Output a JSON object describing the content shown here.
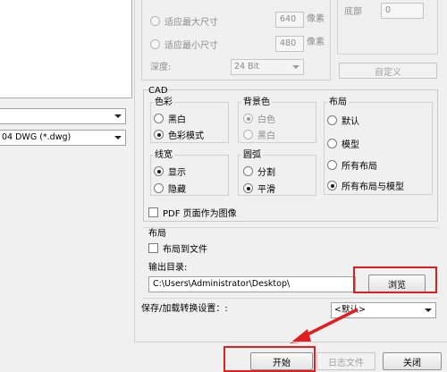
{
  "left": {
    "combo1_value": "",
    "combo2_value": "04 DWG (*.dwg)"
  },
  "image_size": {
    "fit_max_label": "适应最大尺寸",
    "fit_max_value": "640",
    "fit_min_label": "适应最小尺寸",
    "fit_min_value": "480",
    "pixel_unit": "像素",
    "depth_label": "深度:",
    "depth_value": "24 Bit"
  },
  "margins": {
    "bottom_label": "底部",
    "bottom_value": "0",
    "custom_button": "自定义"
  },
  "cad": {
    "title": "CAD",
    "color": {
      "title": "色彩",
      "options": [
        "黑白",
        "色彩模式"
      ],
      "selected": 1
    },
    "background": {
      "title": "背景色",
      "options": [
        "白色",
        "黑白"
      ],
      "selected": 0
    },
    "layout": {
      "title": "布局",
      "options": [
        "默认",
        "模型",
        "所有布局",
        "所有布局与模型"
      ],
      "selected": 3
    },
    "lineweight": {
      "title": "线宽",
      "options": [
        "显示",
        "隐藏"
      ],
      "selected": 0
    },
    "arc": {
      "title": "圆弧",
      "options": [
        "分割",
        "平滑"
      ],
      "selected": 1
    },
    "pdf_layer_label": "PDF 页面作为图像"
  },
  "layout_section": {
    "title": "布局",
    "layout_to_file_label": "布局到文件"
  },
  "output": {
    "label": "输出目录:",
    "path": "C:\\Users\\Administrator\\Desktop\\",
    "browse_button": "浏览"
  },
  "settings": {
    "label": "保存/加载转换设置：:",
    "value": "<默认>"
  },
  "buttons": {
    "start": "开始",
    "log": "日志文件",
    "close": "关闭"
  },
  "colors": {
    "highlight": "#e02020",
    "arrow": "#e02020"
  }
}
